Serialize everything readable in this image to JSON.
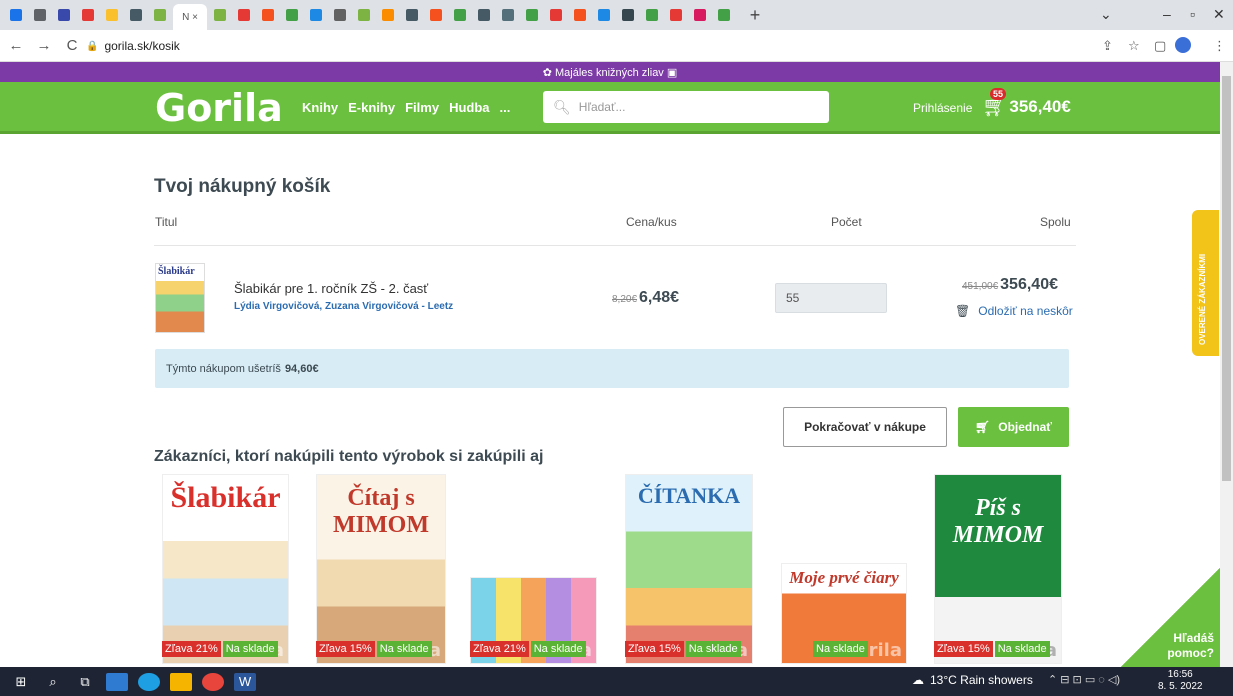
{
  "browser": {
    "url": "gorila.sk/kosik",
    "tab_colors": [
      "#1a73e8",
      "#5f6368",
      "#3949ab",
      "#e53935",
      "#fbc02d",
      "#455a64",
      "#7cb342",
      "#fff",
      "#7cb342",
      "#e53935",
      "#f4511e",
      "#43a047",
      "#1e88e5",
      "#616161",
      "#7cb342",
      "#fb8c00",
      "#455a64",
      "#f4511e",
      "#43a047",
      "#455a64",
      "#546e7a",
      "#43a047",
      "#e53935",
      "#f4511e",
      "#1e88e5",
      "#37474f",
      "#43a047",
      "#e53935",
      "#d81b60",
      "#43a047"
    ],
    "active_tab_label": "N ×",
    "new_tab": "+",
    "nav": {
      "back": "←",
      "forward": "→",
      "reload": "C"
    },
    "icons": [
      "share-icon",
      "star-icon",
      "sidebar-icon",
      "profile-icon",
      "menu-icon"
    ]
  },
  "promo": {
    "text": "✿ Majáles knižných zliav ▣"
  },
  "header": {
    "logo": "Gorila",
    "nav": [
      "Knihy",
      "E-knihy",
      "Filmy",
      "Hudba",
      "..."
    ],
    "search_placeholder": "Hľadať...",
    "login": "Prihlásenie",
    "cart_count": "55",
    "cart_total": "356,40€"
  },
  "cart": {
    "title": "Tvoj nákupný košík",
    "columns": {
      "title": "Titul",
      "price": "Cena/kus",
      "qty": "Počet",
      "total": "Spolu"
    },
    "item": {
      "cover_text": "Šlabikár",
      "title": "Šlabikár pre 1. ročník ZŠ - 2. časť",
      "authors": "Lýdia Virgovičová, Zuzana Virgovičová - Leetz",
      "old_price": "8,20€",
      "price": "6,48€",
      "qty": "55",
      "old_total": "451,00€",
      "total": "356,40€",
      "later": "Odložiť na neskôr"
    },
    "savings_label": "Týmto nákupom ušetríš",
    "savings_value": "94,60€",
    "continue": "Pokračovať v nákupe",
    "order": "Objednať"
  },
  "recommendations": {
    "title": "Zákazníci, ktorí nakúpili tento výrobok si zakúpili aj",
    "items": [
      {
        "cover": "Šlabikár",
        "discount": "Zľava 21%",
        "stock": "Na sklade"
      },
      {
        "cover": "Čítaj s MIMOM",
        "discount": "Zľava 15%",
        "stock": "Na sklade"
      },
      {
        "cover": "",
        "discount": "Zľava 21%",
        "stock": "Na sklade"
      },
      {
        "cover": "ČÍTANKA",
        "discount": "Zľava 15%",
        "stock": "Na sklade"
      },
      {
        "cover": "Moje prvé čiary",
        "discount": "",
        "stock": "Na sklade"
      },
      {
        "cover": "Píš s MIMOM",
        "discount": "Zľava 15%",
        "stock": "Na sklade"
      }
    ],
    "watermark": "Gorila"
  },
  "side": {
    "verified": "OVERENÉ ZÁKAZNÍKMI",
    "help": "Hľadáš\npomoc?"
  },
  "taskbar": {
    "weather": "13°C Rain showers",
    "time": "16:56",
    "date": "8. 5. 2022"
  }
}
